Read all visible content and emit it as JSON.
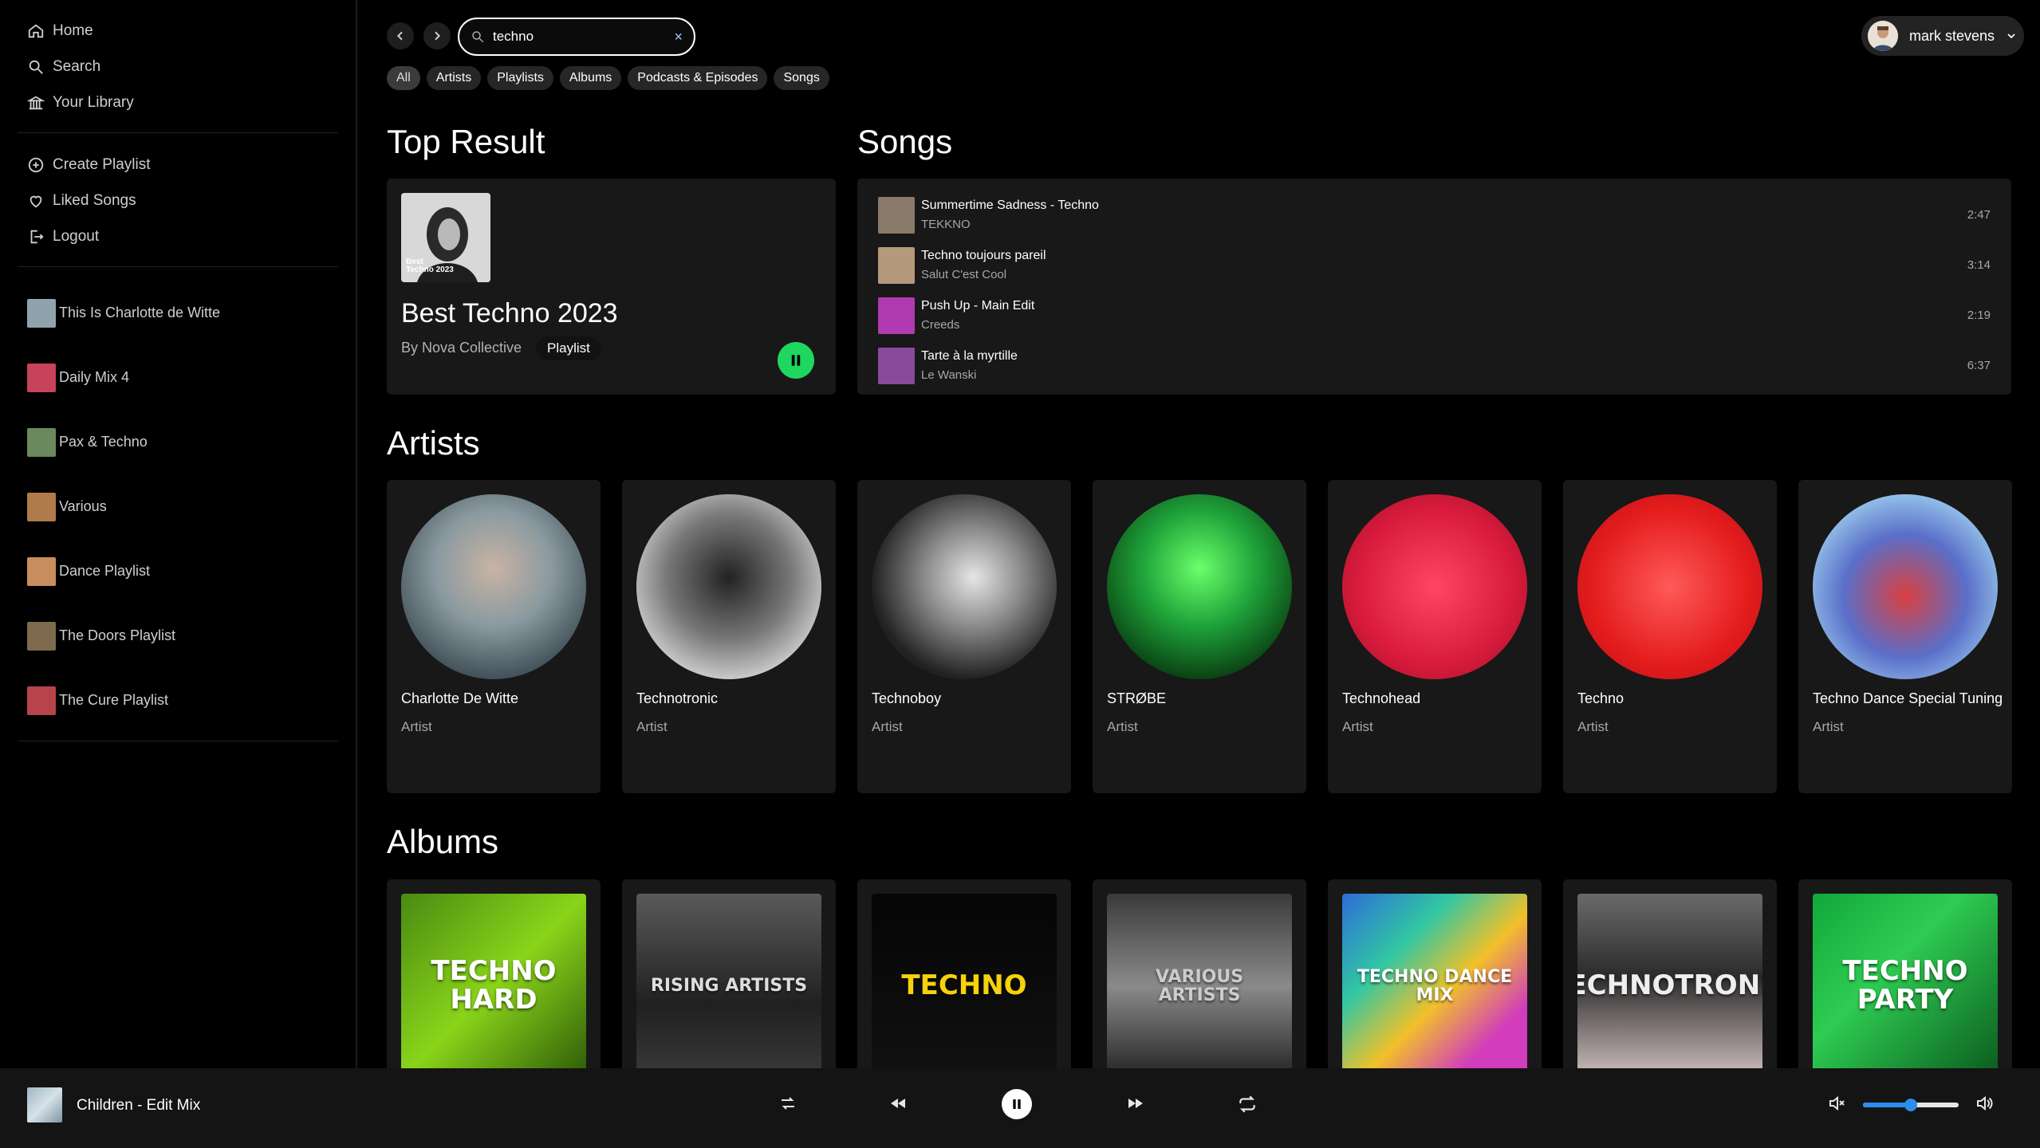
{
  "nav": {
    "home": "Home",
    "search": "Search",
    "library": "Your Library",
    "create_playlist": "Create Playlist",
    "liked_songs": "Liked Songs",
    "logout": "Logout"
  },
  "playlists": [
    {
      "label": "This Is Charlotte de Witte",
      "color": "#8fa3ad"
    },
    {
      "label": "Daily Mix 4",
      "color": "#c7435a"
    },
    {
      "label": "Pax & Techno",
      "color": "#6a8a5d"
    },
    {
      "label": "Various",
      "color": "#b07b4a"
    },
    {
      "label": "Dance Playlist",
      "color": "#c98e5d"
    },
    {
      "label": "The Doors Playlist",
      "color": "#7d6a4d"
    },
    {
      "label": "The Cure Playlist",
      "color": "#b8434a"
    }
  ],
  "search": {
    "value": "techno",
    "clear": "×"
  },
  "filters": [
    "All",
    "Artists",
    "Playlists",
    "Albums",
    "Podcasts & Episodes",
    "Songs"
  ],
  "user": {
    "name": "mark stevens"
  },
  "sections": {
    "top_result": "Top Result",
    "songs": "Songs",
    "artists": "Artists",
    "albums": "Albums"
  },
  "top_result": {
    "cover_text_1": "Best",
    "cover_text_2": "Techno 2023",
    "title": "Best Techno 2023",
    "by": "By Nova Collective",
    "badge": "Playlist"
  },
  "songs": [
    {
      "title": "Summertime Sadness - Techno",
      "artist": "TEKKNO",
      "duration": "2:47",
      "color": "#8a7a6a"
    },
    {
      "title": "Techno toujours pareil",
      "artist": "Salut C'est Cool",
      "duration": "3:14",
      "color": "#b49a7a"
    },
    {
      "title": "Push Up - Main Edit",
      "artist": "Creeds",
      "duration": "2:19",
      "color": "#b03ab0"
    },
    {
      "title": "Tarte à la myrtille",
      "artist": "Le Wanski",
      "duration": "6:37",
      "color": "#8a4a9a"
    }
  ],
  "artists": [
    {
      "name": "Charlotte De Witte",
      "type": "Artist",
      "bg": "radial-gradient(circle at 50% 40%, #c9b3a4 0%, #8a9aa0 40%, #3b4a52 80%)"
    },
    {
      "name": "Technotronic",
      "type": "Artist",
      "bg": "radial-gradient(circle at 50% 45%, #222 0%, #777 45%, #ccc 75%, #555 100%)"
    },
    {
      "name": "Technoboy",
      "type": "Artist",
      "bg": "radial-gradient(circle at 55% 45%, #e6e6e6 0%, #888 35%, #222 70%, #111 100%)"
    },
    {
      "name": "STRØBE",
      "type": "Artist",
      "bg": "radial-gradient(circle at 50% 40%, #6bff6b 0%, #1fa33a 40%, #083a10 80%)"
    },
    {
      "name": "Technohead",
      "type": "Artist",
      "bg": "radial-gradient(circle at 50% 50%, #ff4466 0%, #d81b3c 60%, #9a0f27 100%)"
    },
    {
      "name": "Techno",
      "type": "Artist",
      "bg": "radial-gradient(circle at 50% 50%, #ff5a5a 0%, #e41c1c 60%, #b80f1e 100%)"
    },
    {
      "name": "Techno Dance Special Tuning",
      "type": "Artist",
      "bg": "radial-gradient(circle at 50% 55%, #d94040 0%, #5a6fc9 45%, #9ed0ee 80%)"
    }
  ],
  "albums": [
    {
      "label": "TECHNO HARD",
      "bg": "linear-gradient(135deg,#4a8a12,#8ad41a 50%,#2d5a08)",
      "fg": "#fff"
    },
    {
      "label": "RISING ARTISTS",
      "bg": "linear-gradient(180deg,#5a5a5a,#202020 60%,#3a3a3a)",
      "fg": "#ddd"
    },
    {
      "label": "TECHNO",
      "bg": "linear-gradient(180deg,#050505,#111)",
      "fg": "#f5d20a"
    },
    {
      "label": "VARIOUS ARTISTS",
      "bg": "linear-gradient(180deg,#3a3a3a,#8a8a8a 50%,#222)",
      "fg": "#ccc"
    },
    {
      "label": "TECHNO DANCE MIX",
      "bg": "linear-gradient(135deg,#2d6cd9,#31c7a3 30%,#f2c029 55%,#d13dbb 80%)",
      "fg": "#fff"
    },
    {
      "label": "TECHNOTRONIC",
      "bg": "linear-gradient(180deg,#6a6a6a,#2b2b2b 45%,#d2c0c0)",
      "fg": "#eee"
    },
    {
      "label": "TECHNO PARTY",
      "bg": "linear-gradient(135deg,#11a83a,#2ecc52 40%,#0b5a1e)",
      "fg": "#fff"
    }
  ],
  "player": {
    "now_playing": "Children - Edit Mix",
    "volume": 0.5
  }
}
